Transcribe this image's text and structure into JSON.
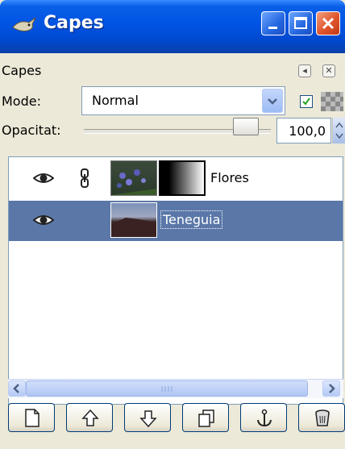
{
  "window": {
    "title": "Capes",
    "title_icon": "gimp-wilber-icon",
    "buttons": [
      "minimize-icon",
      "maximize-icon",
      "close-icon"
    ]
  },
  "panel": {
    "tab_label": "Capes",
    "mode_label": "Mode:",
    "mode_value": "Normal",
    "opacity_label": "Opacitat:",
    "opacity_value": "100,0",
    "opacity_level": 1.0
  },
  "layers": [
    {
      "name": "Flores",
      "visible": true,
      "linked": true,
      "has_mask": true,
      "selected": false
    },
    {
      "name": "Teneguia",
      "visible": true,
      "linked": false,
      "has_mask": false,
      "selected": true
    }
  ],
  "toolbar": {
    "buttons": [
      "new-layer-icon",
      "raise-layer-icon",
      "lower-layer-icon",
      "duplicate-layer-icon",
      "anchor-layer-icon",
      "delete-layer-icon"
    ]
  },
  "colors": {
    "title_blue": "#0054e3",
    "selection": "#5a77a8",
    "panel_bg": "#ece9d8"
  }
}
